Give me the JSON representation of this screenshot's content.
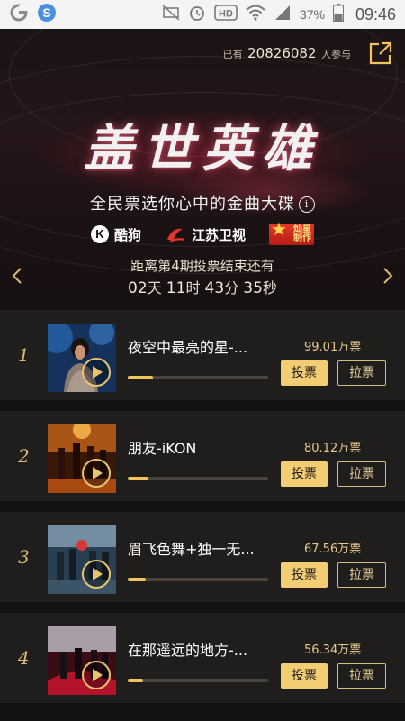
{
  "status_bar": {
    "time": "09:46",
    "battery": "37%",
    "hd_label": "HD"
  },
  "banner": {
    "participants_prefix": "已有",
    "participants_count": "20826082",
    "participants_suffix": "人参与",
    "title": "盖世英雄",
    "subtitle": "全民票选你心中的金曲大碟",
    "logos": {
      "kugou_mark": "K",
      "kugou": "酷狗",
      "jiangsu": "江苏卫视",
      "star_top": "灿星",
      "star_bottom": "制作"
    },
    "countdown_label": "距离第4期投票结束还有",
    "countdown": {
      "days": "02",
      "days_unit": "天",
      "hours": "11",
      "hours_unit": "时",
      "minutes": "43",
      "minutes_unit": "分",
      "seconds": "35",
      "seconds_unit": "秒"
    }
  },
  "songs": [
    {
      "rank": "1",
      "title": "夜空中最亮的星-...",
      "votes": "99.01万票",
      "progress": 0.18,
      "vote_label": "投票",
      "pull_label": "拉票"
    },
    {
      "rank": "2",
      "title": "朋友-iKON",
      "votes": "80.12万票",
      "progress": 0.15,
      "vote_label": "投票",
      "pull_label": "拉票"
    },
    {
      "rank": "3",
      "title": "眉飞色舞+独一无...",
      "votes": "67.56万票",
      "progress": 0.13,
      "vote_label": "投票",
      "pull_label": "拉票"
    },
    {
      "rank": "4",
      "title": "在那遥远的地方-...",
      "votes": "56.34万票",
      "progress": 0.11,
      "vote_label": "投票",
      "pull_label": "拉票"
    }
  ],
  "colors": {
    "accent_gold": "#f3cd74",
    "background": "#141210",
    "row_background": "#201e1c"
  }
}
